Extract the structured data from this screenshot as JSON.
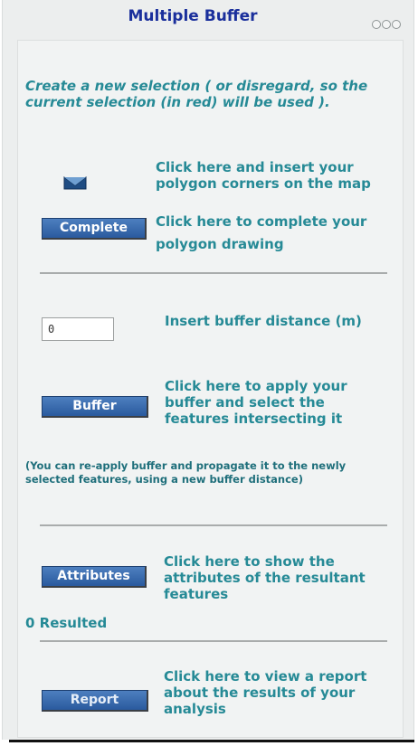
{
  "window": {
    "title": "Multiple Buffer"
  },
  "intro_text": "Create a new selection ( or disregard, so the current selection (in red) will be used ).",
  "polygon": {
    "tool_icon": "polygon-draw-icon",
    "insert_hint": "Click here and insert your polygon corners on the map",
    "complete_label": "Complete",
    "complete_hint": "Click here to complete your polygon drawing"
  },
  "buffer": {
    "distance_value": "0",
    "distance_label": "Insert buffer distance (m)",
    "button_label": "Buffer",
    "button_hint": "Click here to apply your buffer and select the features intersecting it",
    "note": "(You can re-apply buffer and propagate it to the newly selected features, using a new buffer distance)"
  },
  "attributes": {
    "button_label": "Attributes",
    "button_hint": "Click here to show the attributes of the resultant features",
    "result_count": "0 Resulted"
  },
  "report": {
    "button_label": "Report",
    "button_hint": "Click here to view a report about the results of your analysis"
  },
  "colors": {
    "title": "#1a2f9c",
    "text": "#268a96",
    "button": "#2a5a9e"
  }
}
